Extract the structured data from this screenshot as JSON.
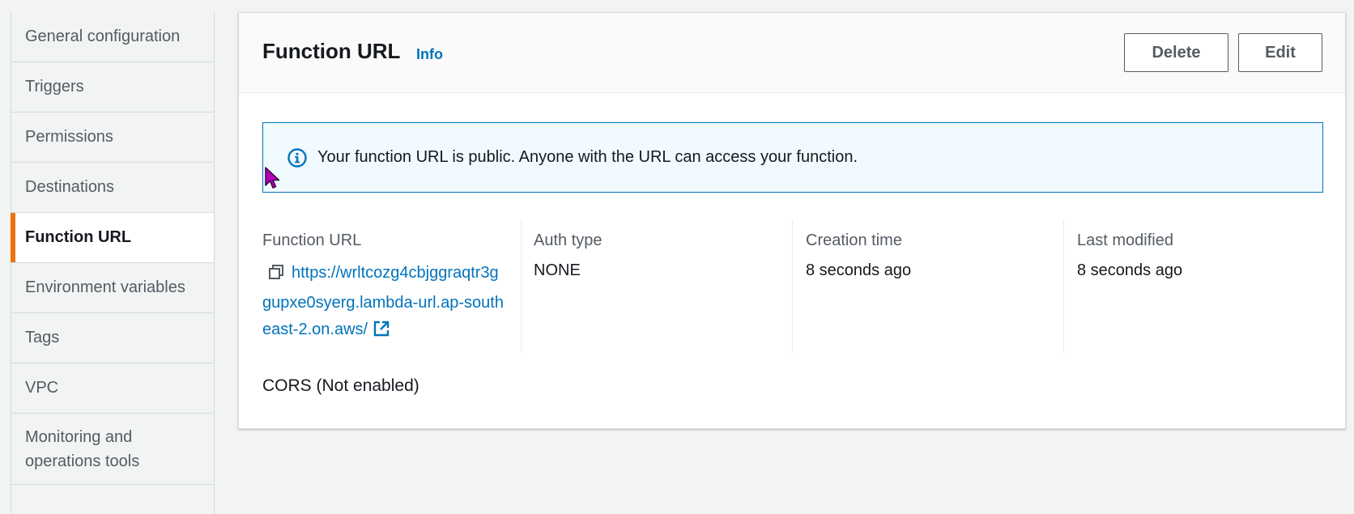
{
  "sidebar": {
    "items": [
      {
        "label": "General configuration"
      },
      {
        "label": "Triggers"
      },
      {
        "label": "Permissions"
      },
      {
        "label": "Destinations"
      },
      {
        "label": "Function URL"
      },
      {
        "label": "Environment variables"
      },
      {
        "label": "Tags"
      },
      {
        "label": "VPC"
      },
      {
        "label": "Monitoring and operations tools"
      }
    ],
    "active": "Function URL"
  },
  "panel": {
    "title": "Function URL",
    "info_label": "Info",
    "delete_label": "Delete",
    "edit_label": "Edit",
    "alert_text": "Your function URL is public. Anyone with the URL can access your function.",
    "columns": {
      "url_label": "Function URL",
      "url_value": "https://wrltcozg4cbjggraqtr3ggupxe0syerg.lambda-url.ap-southeast-2.on.aws/",
      "auth_label": "Auth type",
      "auth_value": "NONE",
      "created_label": "Creation time",
      "created_value": "8 seconds ago",
      "modified_label": "Last modified",
      "modified_value": "8 seconds ago"
    },
    "cors_text": "CORS (Not enabled)"
  },
  "colors": {
    "accent_active": "#ec7211",
    "link": "#0073bb",
    "alert_bg": "#f1faff"
  },
  "icons": [
    "info-circle-icon",
    "copy-icon",
    "external-link-icon",
    "mouse-cursor-icon"
  ]
}
